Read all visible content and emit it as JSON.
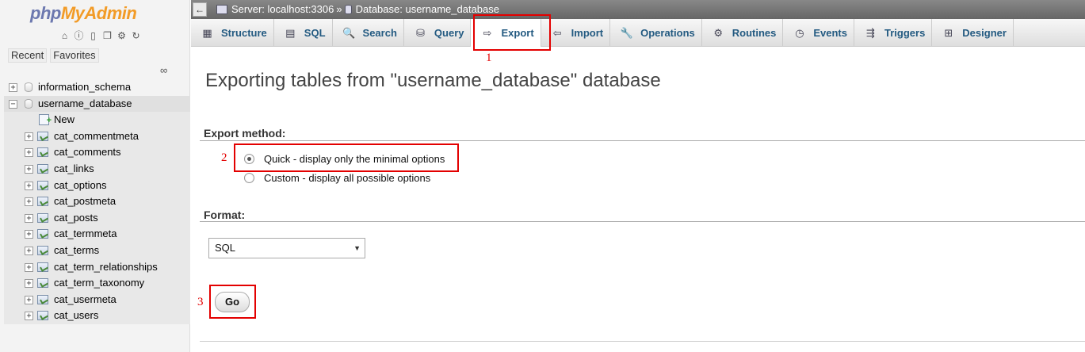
{
  "nav": {
    "logo_php": "php",
    "logo_myadmin": "MyAdmin",
    "recent": "Recent",
    "favorites": "Favorites",
    "databases": [
      {
        "name": "information_schema"
      },
      {
        "name": "username_database"
      }
    ],
    "new_label": "New",
    "tables": [
      "cat_commentmeta",
      "cat_comments",
      "cat_links",
      "cat_options",
      "cat_postmeta",
      "cat_posts",
      "cat_termmeta",
      "cat_terms",
      "cat_term_relationships",
      "cat_term_taxonomy",
      "cat_usermeta",
      "cat_users"
    ],
    "icons": [
      "home-icon",
      "info-icon",
      "docs-icon",
      "copy-icon",
      "settings-icon",
      "reload-icon"
    ]
  },
  "topbar": {
    "back": "←",
    "server": "Server: localhost:3306",
    "separator": "»",
    "database": "Database: username_database"
  },
  "tabs": [
    {
      "label": "Structure",
      "icon": "structure-icon",
      "glyph": "▦"
    },
    {
      "label": "SQL",
      "icon": "sql-icon",
      "glyph": "▤"
    },
    {
      "label": "Search",
      "icon": "search-icon",
      "glyph": "🔍"
    },
    {
      "label": "Query",
      "icon": "query-icon",
      "glyph": "⛁"
    },
    {
      "label": "Export",
      "icon": "export-icon",
      "glyph": "⇨",
      "active": true
    },
    {
      "label": "Import",
      "icon": "import-icon",
      "glyph": "⇦"
    },
    {
      "label": "Operations",
      "icon": "wrench-icon",
      "glyph": "🔧"
    },
    {
      "label": "Routines",
      "icon": "routines-icon",
      "glyph": "⚙"
    },
    {
      "label": "Events",
      "icon": "clock-icon",
      "glyph": "◷"
    },
    {
      "label": "Triggers",
      "icon": "triggers-icon",
      "glyph": "⇶"
    },
    {
      "label": "Designer",
      "icon": "designer-icon",
      "glyph": "⊞"
    }
  ],
  "main": {
    "heading": "Exporting tables from \"username_database\" database",
    "export_method_label": "Export method:",
    "quick_option": "Quick - display only the minimal options",
    "custom_option": "Custom - display all possible options",
    "format_label": "Format:",
    "format_value": "SQL",
    "go_label": "Go"
  },
  "annotations": {
    "marker1": "1",
    "marker2": "2",
    "marker3": "3",
    "color": "#e30000"
  }
}
